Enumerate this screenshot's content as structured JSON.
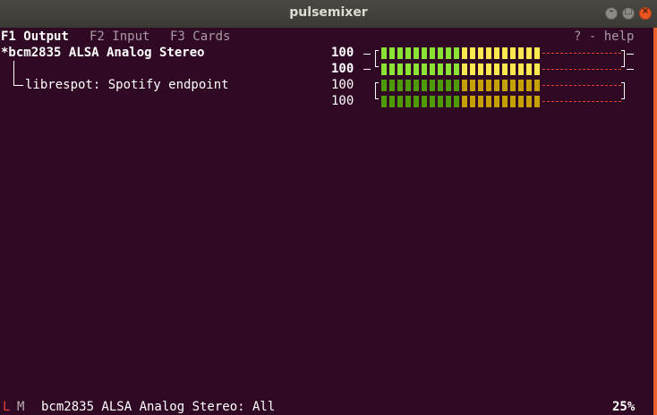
{
  "window": {
    "title": "pulsemixer"
  },
  "tabs": [
    {
      "label": "F1 Output",
      "active": true
    },
    {
      "label": "F2 Input",
      "active": false
    },
    {
      "label": "F3 Cards",
      "active": false
    }
  ],
  "help_label": "? - help",
  "devices": [
    {
      "label": "*bcm2835 ALSA Analog Stereo",
      "selected": true,
      "channels": [
        {
          "volume": "100",
          "level": 1.0
        },
        {
          "volume": "100",
          "level": 1.0
        }
      ]
    },
    {
      "label": "librespot: Spotify endpoint",
      "child": true,
      "channels": [
        {
          "volume": "100",
          "level": 1.0
        },
        {
          "volume": "100",
          "level": 1.0
        }
      ]
    }
  ],
  "status": {
    "lock_label": "L",
    "mute_label": "M",
    "text": "bcm2835 ALSA Analog Stereo: All",
    "percent": "25%"
  },
  "colors": {
    "bg": "#300a24",
    "green_bright": "#8ae234",
    "yellow_bright": "#fce94f",
    "green_dim": "#4e9a06",
    "yellow_dim": "#c4a000",
    "accent": "#e95420",
    "dash": "#e64030"
  }
}
